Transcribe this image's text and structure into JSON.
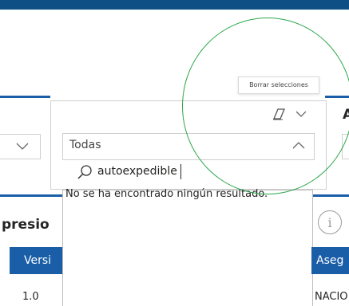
{
  "colors": {
    "header_blue": "#1a5ea8",
    "top_bar": "#0e4f86",
    "annotation_circle": "#2aa64a"
  },
  "tooltip": {
    "text": "Borrar selecciones"
  },
  "slicer": {
    "eraser_icon": "eraser-icon",
    "chevron_icon": "chevron-down-icon",
    "selected_value": "Todas",
    "search": {
      "icon": "search-icon",
      "value": "autoexpedible"
    },
    "no_results": "No se ha encontrado ningún resultado."
  },
  "right_partial_label": "A",
  "section": {
    "title": "presio"
  },
  "table": {
    "headers": [
      "Versi",
      "Aseg"
    ],
    "row": [
      "1.0",
      "NACIO"
    ]
  },
  "info_icon": "info-icon"
}
